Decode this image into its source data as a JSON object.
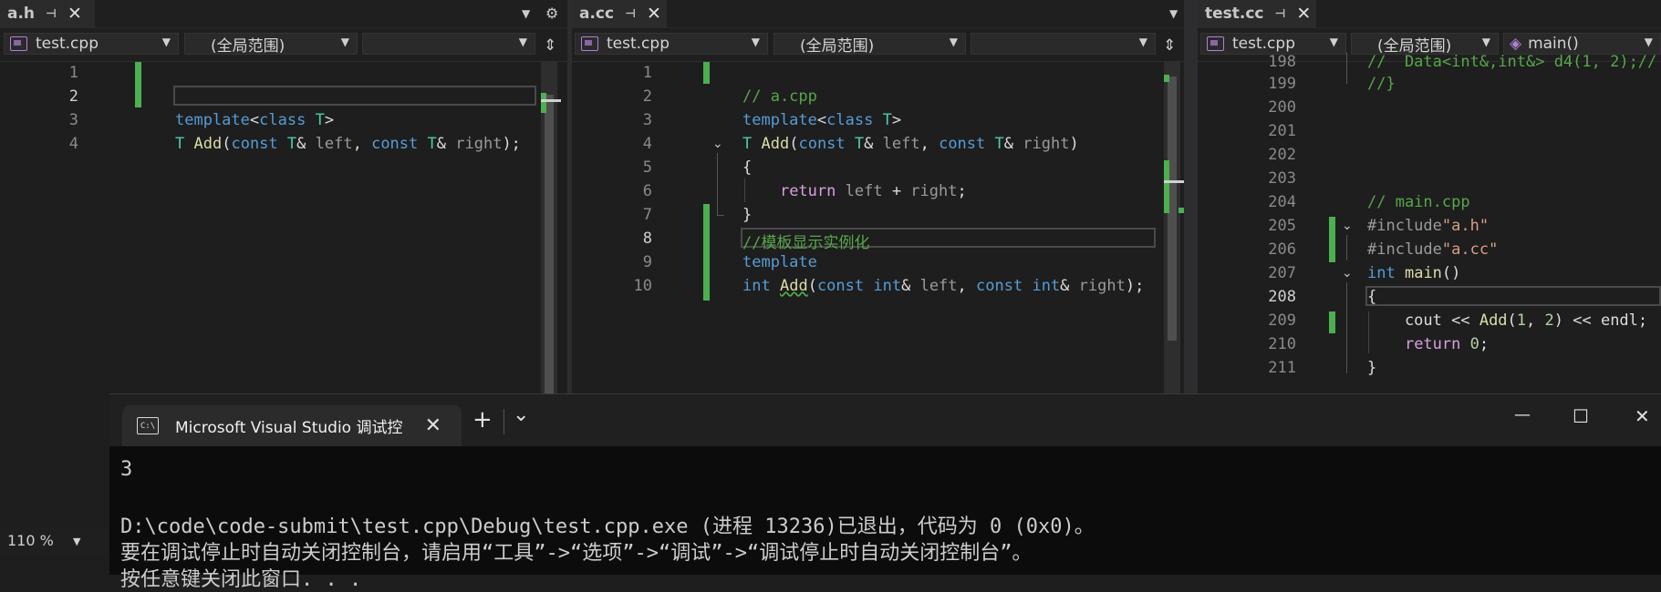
{
  "pane1": {
    "tab": {
      "title": "a.h",
      "pin": "⊣",
      "close": "✕"
    },
    "file_combo": "test.cpp",
    "scope_combo": "(全局范围)",
    "member_combo": "",
    "line_numbers": [
      "1",
      "2",
      "3",
      "4"
    ],
    "code": [
      "",
      "",
      "template<class T>",
      "T Add(const T& left, const T& right);"
    ],
    "zoom": "110 %"
  },
  "pane2": {
    "tab": {
      "title": "a.cc",
      "pin": "⊣",
      "close": "✕"
    },
    "file_combo": "test.cpp",
    "scope_combo": "(全局范围)",
    "member_combo": "",
    "line_numbers": [
      "1",
      "2",
      "3",
      "4",
      "5",
      "6",
      "7",
      "8",
      "9",
      "10"
    ],
    "code": [
      "",
      "// a.cpp",
      "template<class T>",
      "T Add(const T& left, const T& right)",
      "{",
      "    return left + right;",
      "}",
      "//模板显示实例化",
      "template",
      "int Add(const int& left, const int& right);"
    ]
  },
  "pane3": {
    "tab": {
      "title": "test.cc",
      "pin": "⊣",
      "close": "✕"
    },
    "file_combo": "test.cpp",
    "scope_combo": "(全局范围)",
    "member_combo": "main()",
    "line_numbers": [
      "198",
      "199",
      "200",
      "201",
      "202",
      "203",
      "204",
      "205",
      "206",
      "207",
      "208",
      "209",
      "210",
      "211"
    ],
    "code": [
      "//  Data<int&,int&> d4(1, 2);//",
      "//}",
      "",
      "",
      "",
      "",
      "// main.cpp",
      "#include\"a.h\"",
      "#include\"a.cc\"",
      "int main()",
      "{",
      "    cout << Add(1, 2) << endl;",
      "    return 0;",
      "}"
    ]
  },
  "console": {
    "title": "Microsoft Visual Studio 调试控",
    "icon_text": "C:\\",
    "new_tab": "+",
    "dropdown": "⌄",
    "minimize": "—",
    "maximize": "☐",
    "close": "✕",
    "output": [
      "3",
      "",
      "D:\\code\\code-submit\\test.cpp\\Debug\\test.cpp.exe (进程 13236)已退出，代码为 0 (0x0)。",
      "要在调试停止时自动关闭控制台，请启用“工具”->“选项”->“调试”->“调试停止时自动关闭控制台”。",
      "按任意键关闭此窗口. . ."
    ]
  }
}
